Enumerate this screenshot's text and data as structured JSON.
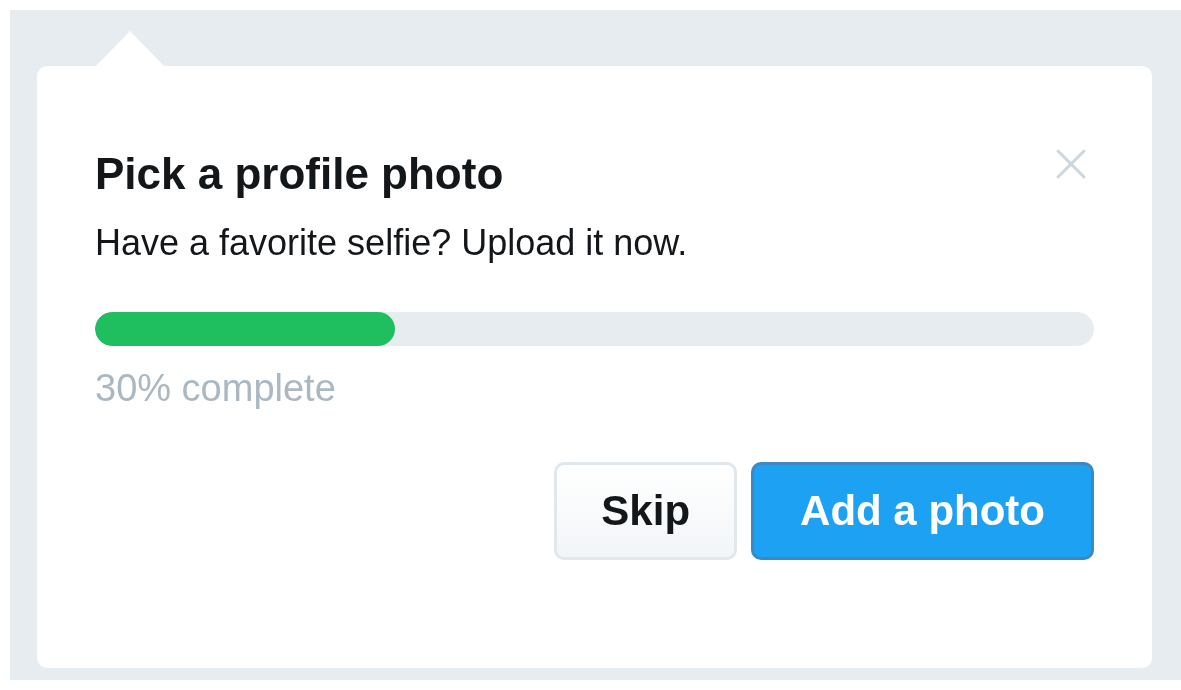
{
  "dialog": {
    "title": "Pick a profile photo",
    "message": "Have a favorite selfie? Upload it now.",
    "progress": {
      "level": 0.3,
      "label": "30% complete"
    },
    "buttons": [
      {
        "label": "Skip",
        "kind": "secondary"
      },
      {
        "label": "Add a photo",
        "kind": "primary"
      }
    ]
  }
}
